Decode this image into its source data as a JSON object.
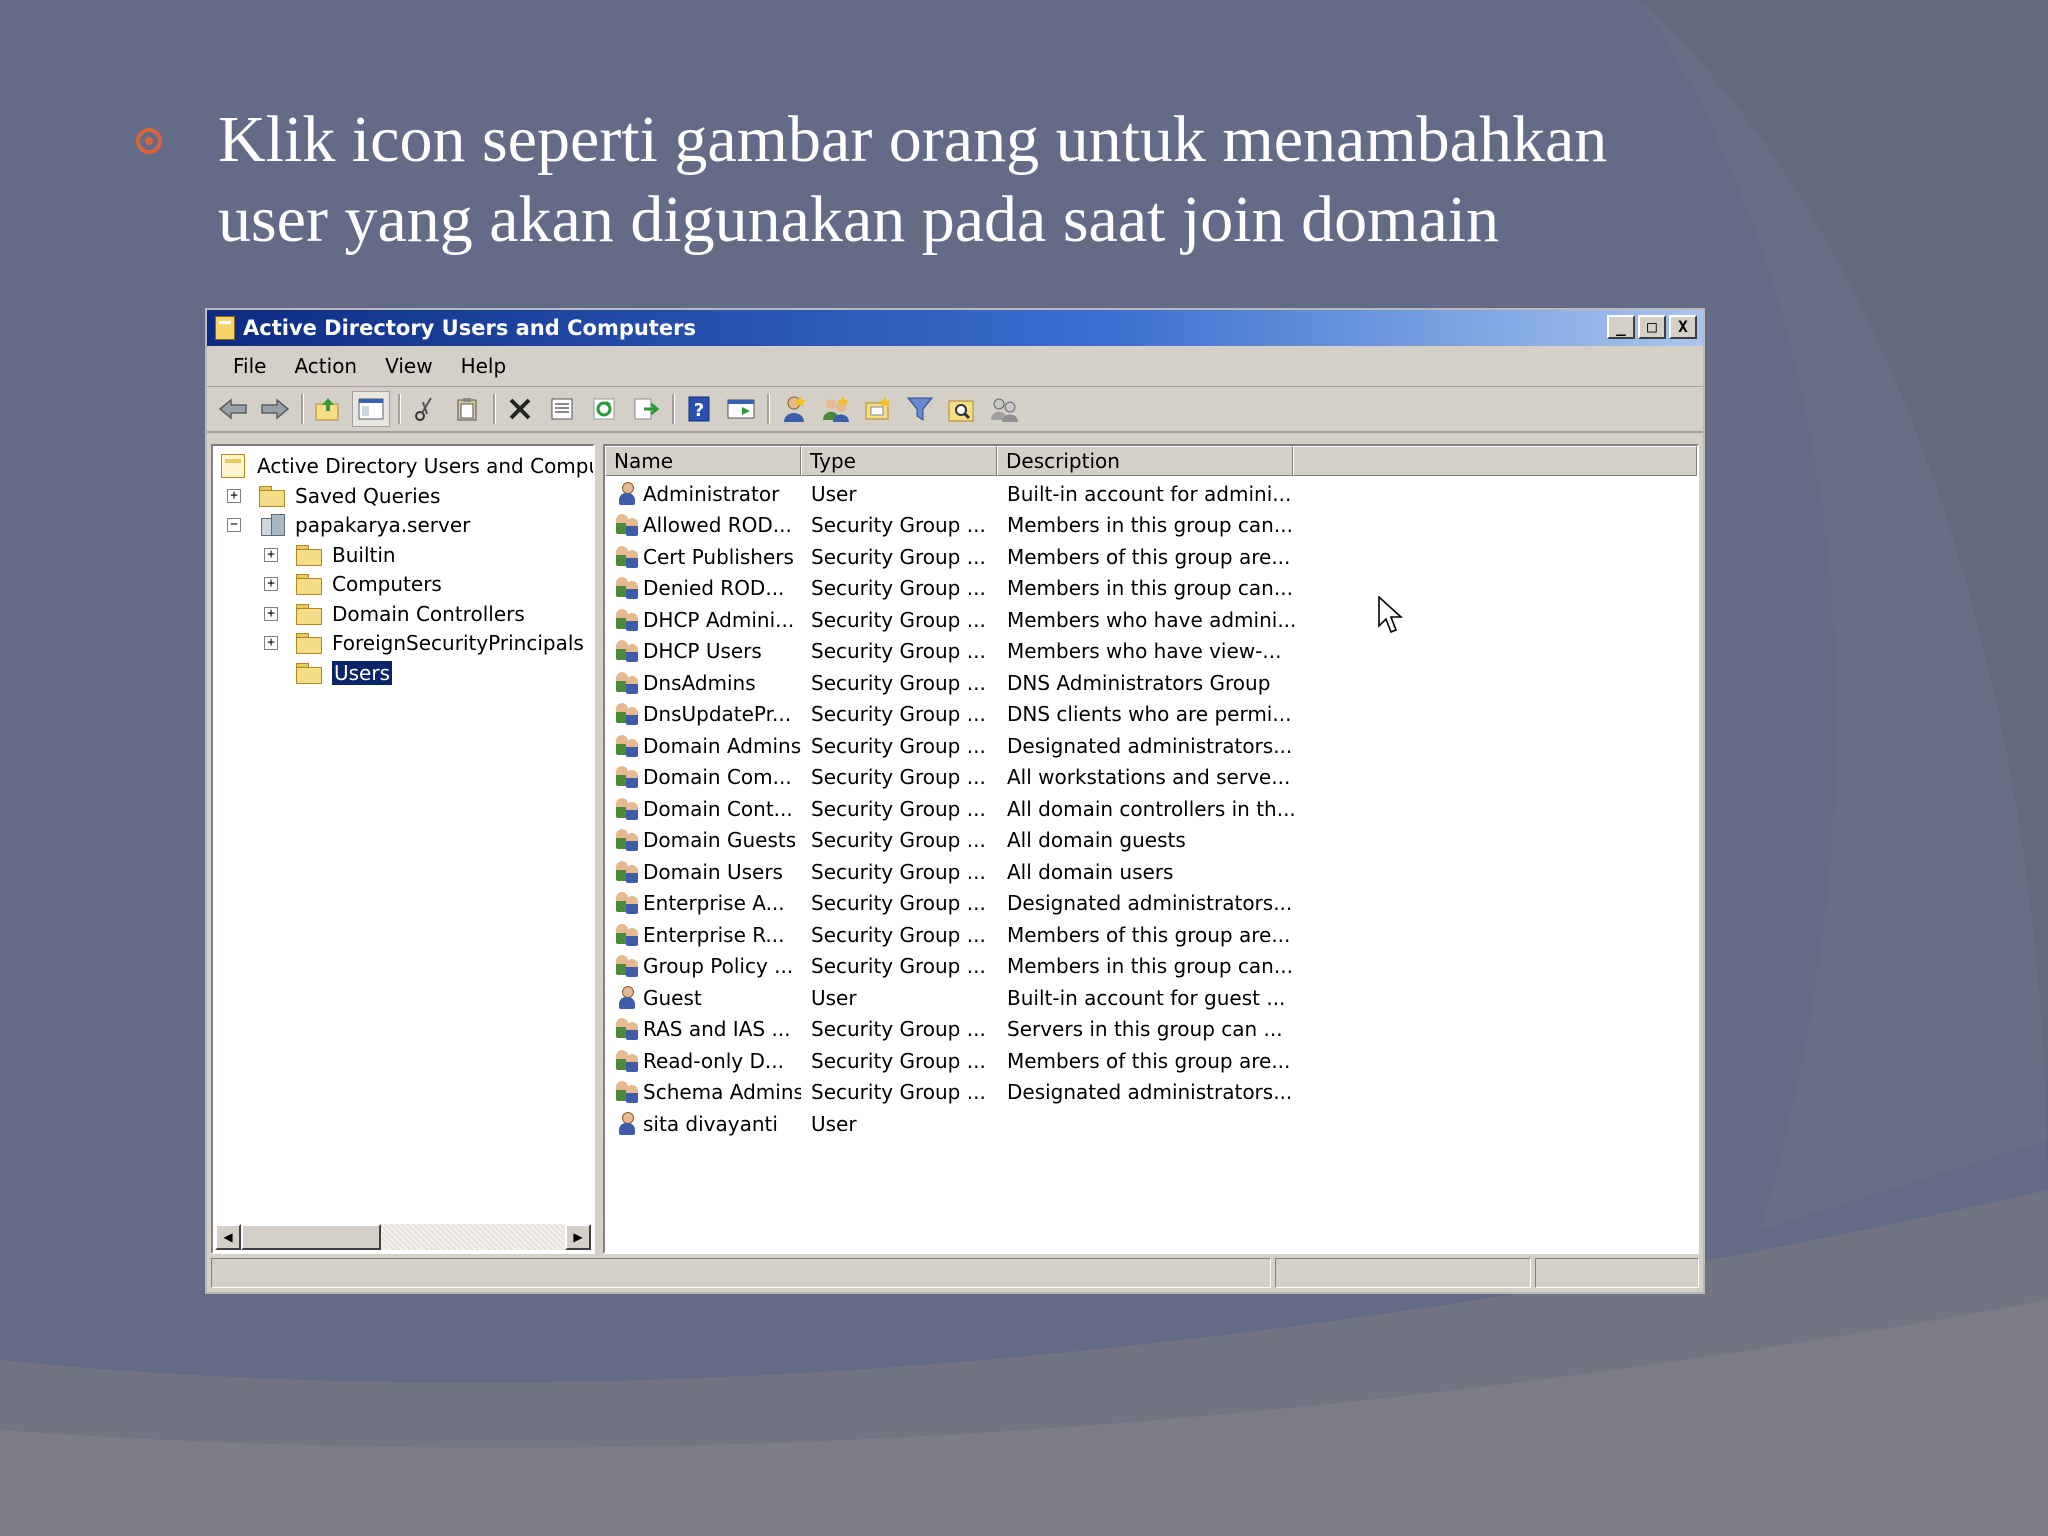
{
  "slide": {
    "bullet_text": "Klik icon seperti gambar orang untuk menambahkan user yang akan digunakan pada saat join domain",
    "accent_color": "#d8643c"
  },
  "window": {
    "title": "Active Directory Users and Computers",
    "title_buttons": {
      "minimize": "_",
      "maximize": "□",
      "close": "X"
    },
    "menu": [
      "File",
      "Action",
      "View",
      "Help"
    ],
    "toolbar_icons": [
      "back-icon",
      "forward-icon",
      "up-folder-icon",
      "show-console-tree-icon",
      "cut-icon",
      "paste-icon",
      "delete-icon",
      "properties-icon",
      "refresh-icon",
      "export-list-icon",
      "help-icon",
      "show-hide-icon",
      "new-user-icon",
      "new-group-icon",
      "new-ou-icon",
      "filter-icon",
      "find-icon",
      "add-to-group-icon"
    ],
    "tree": {
      "root": "Active Directory Users and Comput",
      "saved_queries": "Saved Queries",
      "domain": "papakarya.server",
      "children": [
        "Builtin",
        "Computers",
        "Domain Controllers",
        "ForeignSecurityPrincipals"
      ],
      "selected": "Users"
    },
    "columns": [
      "Name",
      "Type",
      "Description"
    ],
    "rows": [
      {
        "icon": "user",
        "name": "Administrator",
        "type": "User",
        "description": "Built-in account for admini..."
      },
      {
        "icon": "group",
        "name": "Allowed ROD...",
        "type": "Security Group ...",
        "description": "Members in this group can..."
      },
      {
        "icon": "group",
        "name": "Cert Publishers",
        "type": "Security Group ...",
        "description": "Members of this group are..."
      },
      {
        "icon": "group",
        "name": "Denied ROD...",
        "type": "Security Group ...",
        "description": "Members in this group can..."
      },
      {
        "icon": "group",
        "name": "DHCP Admini...",
        "type": "Security Group ...",
        "description": "Members who have admini..."
      },
      {
        "icon": "group",
        "name": "DHCP Users",
        "type": "Security Group ...",
        "description": "Members who have view-..."
      },
      {
        "icon": "group",
        "name": "DnsAdmins",
        "type": "Security Group ...",
        "description": "DNS Administrators Group"
      },
      {
        "icon": "group",
        "name": "DnsUpdatePr...",
        "type": "Security Group ...",
        "description": "DNS clients who are permi..."
      },
      {
        "icon": "group",
        "name": "Domain Admins",
        "type": "Security Group ...",
        "description": "Designated administrators..."
      },
      {
        "icon": "group",
        "name": "Domain Com...",
        "type": "Security Group ...",
        "description": "All workstations and serve..."
      },
      {
        "icon": "group",
        "name": "Domain Cont...",
        "type": "Security Group ...",
        "description": "All domain controllers in th..."
      },
      {
        "icon": "group",
        "name": "Domain Guests",
        "type": "Security Group ...",
        "description": "All domain guests"
      },
      {
        "icon": "group",
        "name": "Domain Users",
        "type": "Security Group ...",
        "description": "All domain users"
      },
      {
        "icon": "group",
        "name": "Enterprise A...",
        "type": "Security Group ...",
        "description": "Designated administrators..."
      },
      {
        "icon": "group",
        "name": "Enterprise R...",
        "type": "Security Group ...",
        "description": "Members of this group are..."
      },
      {
        "icon": "group",
        "name": "Group Policy ...",
        "type": "Security Group ...",
        "description": "Members in this group can..."
      },
      {
        "icon": "user",
        "name": "Guest",
        "type": "User",
        "description": "Built-in account for guest ..."
      },
      {
        "icon": "group",
        "name": "RAS and IAS ...",
        "type": "Security Group ...",
        "description": "Servers in this group can ..."
      },
      {
        "icon": "group",
        "name": "Read-only D...",
        "type": "Security Group ...",
        "description": "Members of this group are..."
      },
      {
        "icon": "group",
        "name": "Schema Admins",
        "type": "Security Group ...",
        "description": "Designated administrators..."
      },
      {
        "icon": "user",
        "name": "sita divayanti",
        "type": "User",
        "description": ""
      }
    ]
  }
}
